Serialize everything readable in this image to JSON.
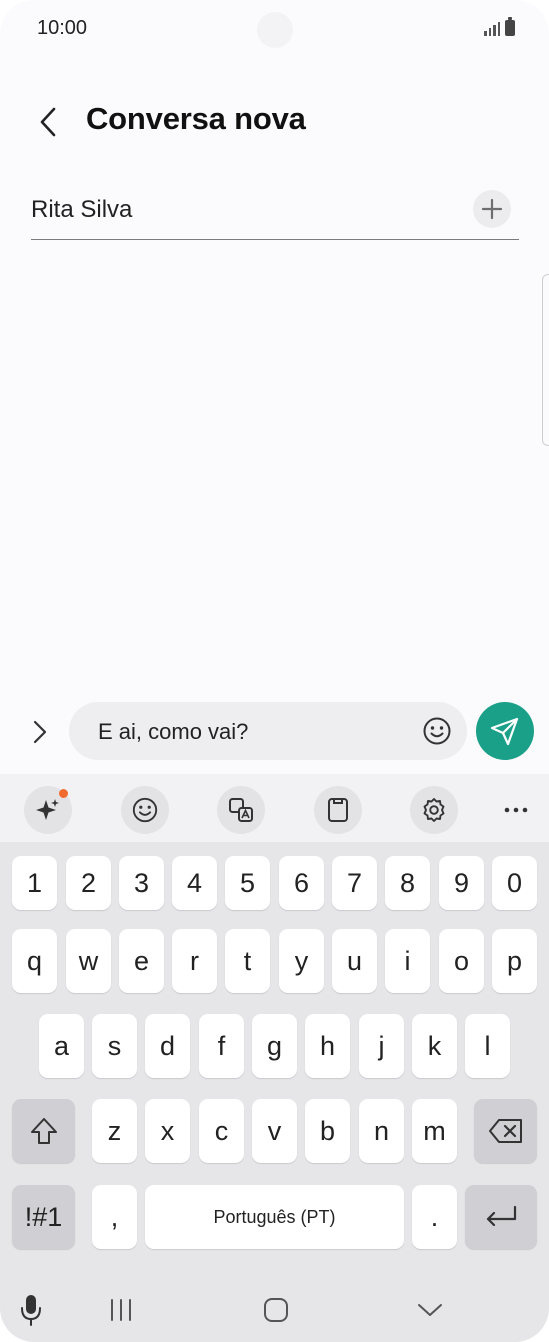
{
  "status_bar": {
    "time": "10:00"
  },
  "header": {
    "title": "Conversa nova"
  },
  "recipient": {
    "name": "Rita Silva"
  },
  "composer": {
    "message": "E ai, como vai?"
  },
  "colors": {
    "send_button": "#1aa088",
    "notification_dot": "#f26b2e"
  },
  "keyboard": {
    "toolbar_icons": [
      "ai-sparkle-icon",
      "emoji-icon",
      "translate-icon",
      "clipboard-icon",
      "settings-gear-icon",
      "more-icon"
    ],
    "number_row": [
      "1",
      "2",
      "3",
      "4",
      "5",
      "6",
      "7",
      "8",
      "9",
      "0"
    ],
    "row1": [
      "q",
      "w",
      "e",
      "r",
      "t",
      "y",
      "u",
      "i",
      "o",
      "p"
    ],
    "row2": [
      "a",
      "s",
      "d",
      "f",
      "g",
      "h",
      "j",
      "k",
      "l"
    ],
    "row3": [
      "z",
      "x",
      "c",
      "v",
      "b",
      "n",
      "m"
    ],
    "symbols_label": "!#1",
    "comma": ",",
    "space_label": "Português (PT)",
    "period": "."
  }
}
